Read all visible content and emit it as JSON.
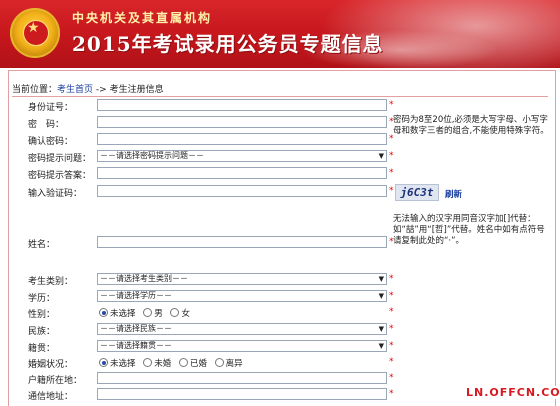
{
  "header": {
    "subtitle": "中央机关及其直属机构",
    "title": "2015年考试录用公务员专题信息"
  },
  "breadcrumb": {
    "prefix": "当前位置：",
    "home": "考生首页",
    "separator": "->",
    "current": "考生注册信息"
  },
  "form": {
    "id_label": "身份证号：",
    "password_label": "密　码：",
    "confirm_label": "确认密码：",
    "hint_question_label": "密码提示问题：",
    "hint_question_value": "－－请选择密码提示问题－－",
    "hint_answer_label": "密码提示答案：",
    "captcha_label": "输入验证码：",
    "captcha_text": "j6C3t",
    "refresh_label": "刷新",
    "name_label": "姓名：",
    "category_label": "考生类别：",
    "category_value": "－－请选择考生类别－－",
    "education_label": "学历：",
    "education_value": "－－请选择学历－－",
    "gender_label": "性别：",
    "gender_options": [
      "未选择",
      "男",
      "女"
    ],
    "ethnicity_label": "民族：",
    "ethnicity_value": "－－请选择民族－－",
    "origin_label": "籍贯：",
    "origin_value": "－－请选择籍贯－－",
    "marital_label": "婚姻状况：",
    "marital_options": [
      "未选择",
      "未婚",
      "已婚",
      "离异"
    ],
    "hukou_label": "户籍所在地：",
    "address_label": "通信地址：",
    "required_mark": "*"
  },
  "notes": {
    "password_rule": "密码为8至20位,必须是大写字母、小写字母和数字三者的组合,不能使用特殊字符。",
    "name_rule": "无法输入的汉字用同音汉字加[]代替：如“喆”用“[哲]”代替。姓名中如有点符号请复制此处的“·”。"
  },
  "watermark": "LN.OFFCN.COM"
}
